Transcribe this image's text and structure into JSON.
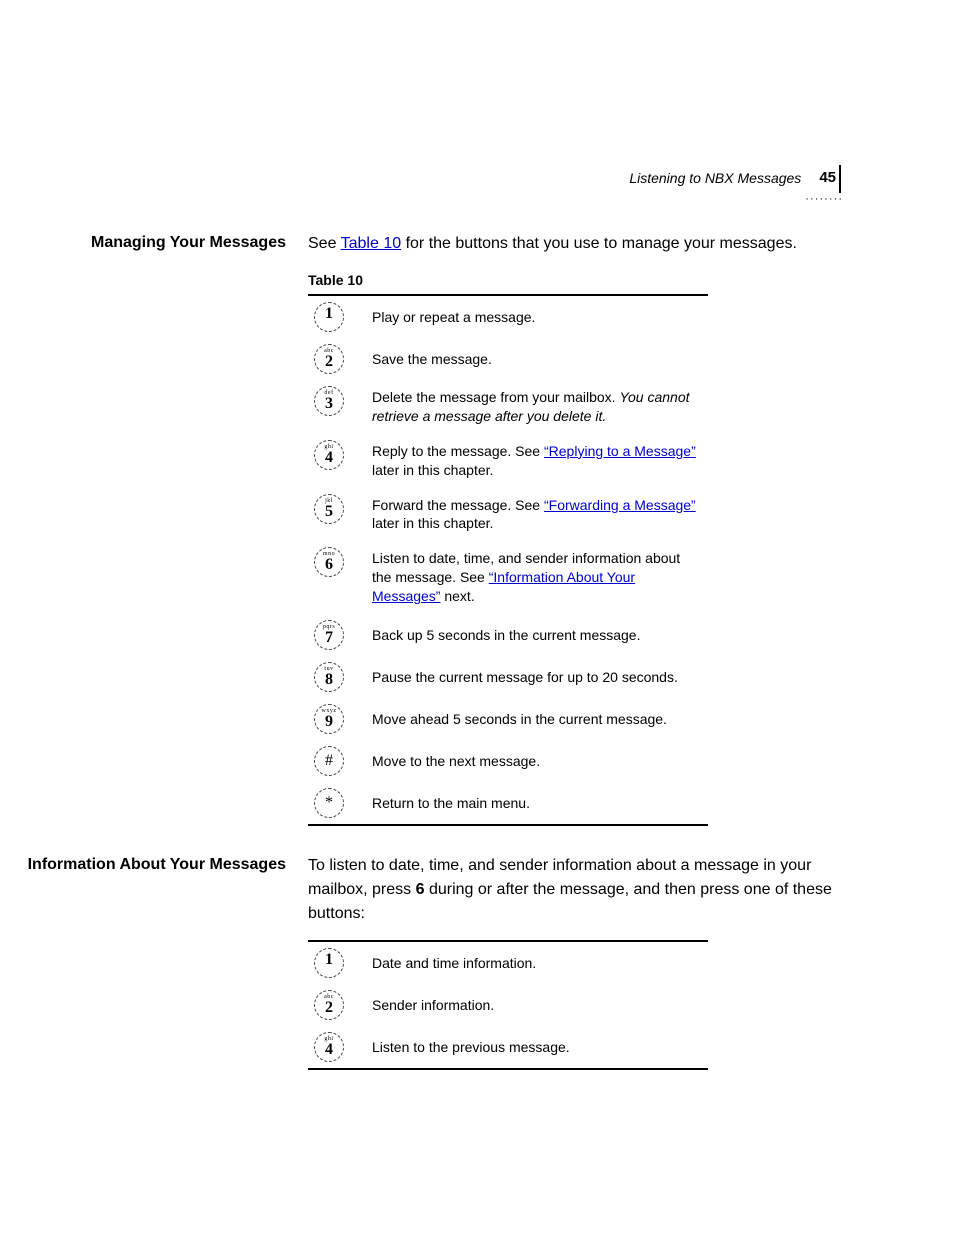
{
  "header": {
    "running_title": "Listening to NBX Messages",
    "page_number": "45"
  },
  "section1": {
    "heading": "Managing Your Messages",
    "intro_before": "See ",
    "intro_link": "Table 10",
    "intro_after": " for the buttons that you use to manage your messages.",
    "table_caption": "Table 10",
    "rows": [
      {
        "digit": "1",
        "letters": "",
        "text": "Play or repeat a message."
      },
      {
        "digit": "2",
        "letters": "abc",
        "text": "Save the message."
      },
      {
        "digit": "3",
        "letters": "def",
        "text_before": "Delete the message from your mailbox. ",
        "italic": "You cannot retrieve a message after you delete it."
      },
      {
        "digit": "4",
        "letters": "ghi",
        "text_before": "Reply to the message. See ",
        "link": "“Replying to a Message”",
        "text_after": " later in this chapter."
      },
      {
        "digit": "5",
        "letters": "jkl",
        "text_before": "Forward the message. See ",
        "link": "“Forwarding a Message”",
        "text_after": " later in this chapter."
      },
      {
        "digit": "6",
        "letters": "mno",
        "text_before": "Listen to date, time, and sender information about the message. See ",
        "link": "“Information About Your Messages”",
        "text_after": " next."
      },
      {
        "digit": "7",
        "letters": "pqrs",
        "text": "Back up 5 seconds in the current message."
      },
      {
        "digit": "8",
        "letters": "tuv",
        "text": "Pause the current message for up to 20 seconds."
      },
      {
        "digit": "9",
        "letters": "wxyz",
        "text": "Move ahead 5 seconds in the current message."
      },
      {
        "digit": "#",
        "letters": "",
        "text": "Move to the next message."
      },
      {
        "digit": "*",
        "letters": "",
        "text": "Return to the main menu."
      }
    ]
  },
  "section2": {
    "heading": "Information About Your Messages",
    "intro_before": "To listen to date, time, and sender information about a message in your mailbox, press ",
    "intro_bold": "6",
    "intro_after": " during or after the message, and then press one of these buttons:",
    "rows": [
      {
        "digit": "1",
        "letters": "",
        "text": "Date and time information."
      },
      {
        "digit": "2",
        "letters": "abc",
        "text": "Sender information."
      },
      {
        "digit": "4",
        "letters": "ghi",
        "text": "Listen to the previous message."
      }
    ]
  }
}
